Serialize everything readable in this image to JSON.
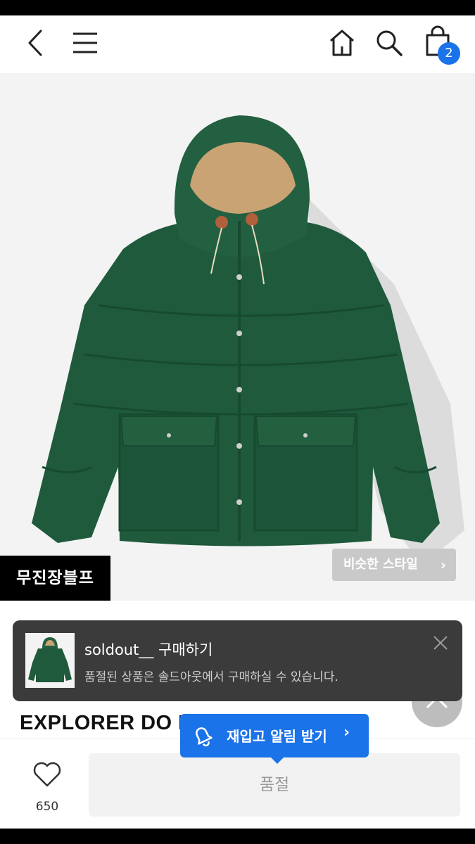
{
  "header": {
    "cart_count": "2"
  },
  "hero": {
    "brand_tag": "무진장블프",
    "similar_style_label": "비슷한 스타일",
    "similar_style_chevron": "›"
  },
  "toast": {
    "title": "soldout__ 구매하기",
    "message": "품절된 상품은 솔드아웃에서 구매하실 수 있습니다."
  },
  "product": {
    "title": "EXPLORER DO                         EN"
  },
  "restock": {
    "label": "재입고 알림 받기",
    "chevron": "›"
  },
  "bottom": {
    "wish_count": "650",
    "soldout_label": "품절"
  },
  "colors": {
    "accent_blue": "#1a73e8",
    "badge_blue": "#1a73e8",
    "jacket_green": "#1f5a3c",
    "toast_bg": "#3b3b3b"
  },
  "icons": [
    "back-icon",
    "menu-icon",
    "home-icon",
    "search-icon",
    "cart-icon",
    "close-icon",
    "bell-icon",
    "heart-icon",
    "chevron-up-icon"
  ]
}
